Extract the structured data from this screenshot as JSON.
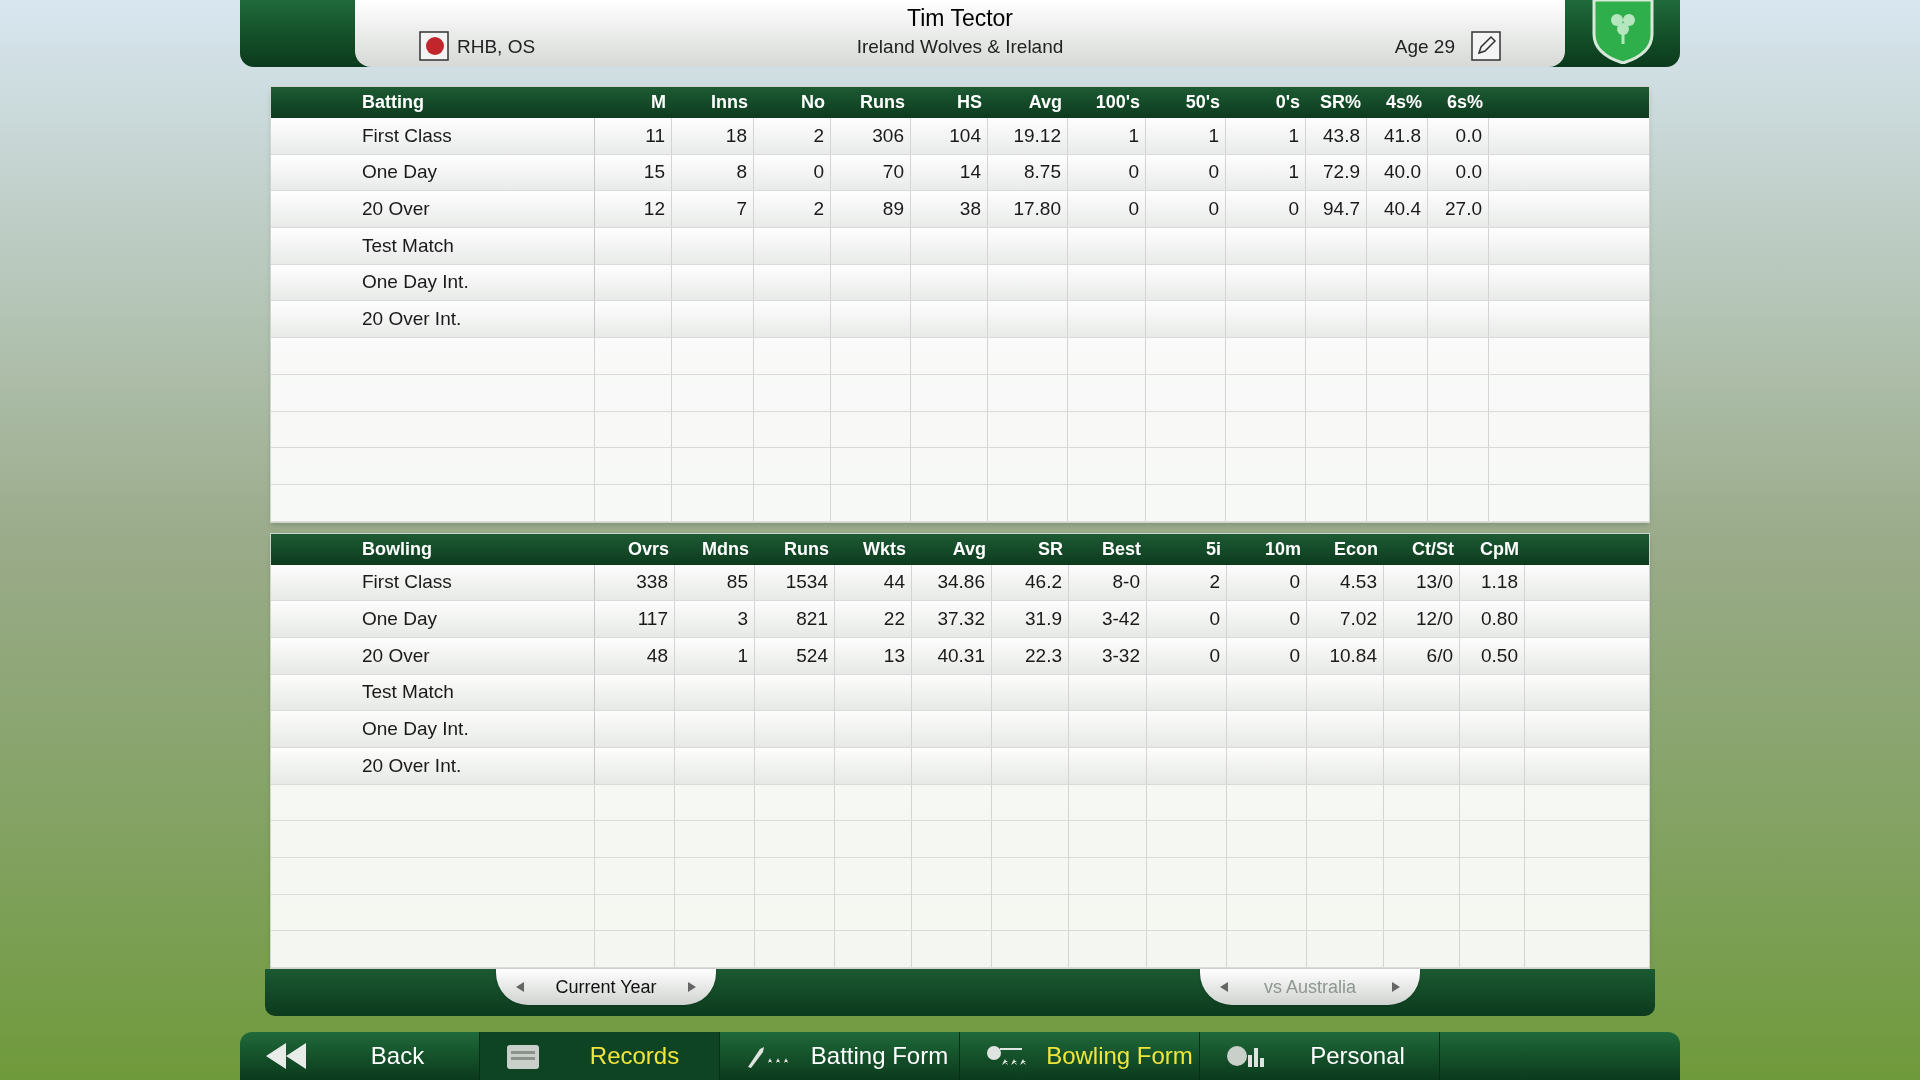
{
  "header": {
    "name": "Tim Tector",
    "handedness": "RHB, OS",
    "team": "Ireland Wolves & Ireland",
    "age": "Age 29"
  },
  "batting": {
    "columns": [
      "Batting",
      "M",
      "Inns",
      "No",
      "Runs",
      "HS",
      "Avg",
      "100's",
      "50's",
      "0's",
      "SR%",
      "4s%",
      "6s%"
    ],
    "rows": [
      {
        "label": "First Class",
        "cells": [
          "11",
          "18",
          "2",
          "306",
          "104",
          "19.12",
          "1",
          "1",
          "1",
          "43.8",
          "41.8",
          "0.0"
        ]
      },
      {
        "label": "One Day",
        "cells": [
          "15",
          "8",
          "0",
          "70",
          "14",
          "8.75",
          "0",
          "0",
          "1",
          "72.9",
          "40.0",
          "0.0"
        ]
      },
      {
        "label": "20 Over",
        "cells": [
          "12",
          "7",
          "2",
          "89",
          "38",
          "17.80",
          "0",
          "0",
          "0",
          "94.7",
          "40.4",
          "27.0"
        ]
      },
      {
        "label": "Test Match"
      },
      {
        "label": "One Day Int."
      },
      {
        "label": "20 Over Int."
      }
    ]
  },
  "bowling": {
    "columns": [
      "Bowling",
      "Ovrs",
      "Mdns",
      "Runs",
      "Wkts",
      "Avg",
      "SR",
      "Best",
      "5i",
      "10m",
      "Econ",
      "Ct/St",
      "CpM"
    ],
    "rows": [
      {
        "label": "First Class",
        "cells": [
          "338",
          "85",
          "1534",
          "44",
          "34.86",
          "46.2",
          "8-0",
          "2",
          "0",
          "4.53",
          "13/0",
          "1.18"
        ]
      },
      {
        "label": "One Day",
        "cells": [
          "117",
          "3",
          "821",
          "22",
          "37.32",
          "31.9",
          "3-42",
          "0",
          "0",
          "7.02",
          "12/0",
          "0.80"
        ]
      },
      {
        "label": "20 Over",
        "cells": [
          "48",
          "1",
          "524",
          "13",
          "40.31",
          "22.3",
          "3-32",
          "0",
          "0",
          "10.84",
          "6/0",
          "0.50"
        ]
      },
      {
        "label": "Test Match"
      },
      {
        "label": "One Day Int."
      },
      {
        "label": "20 Over Int."
      }
    ]
  },
  "period_selector": {
    "label": "Current Year",
    "disabled": false
  },
  "opponent_selector": {
    "label": "vs Australia",
    "disabled": true
  },
  "nav": [
    {
      "kind": "back",
      "label": "Back",
      "selected": false,
      "highlighted": false
    },
    {
      "kind": "records",
      "label": "Records",
      "selected": true,
      "highlighted": true
    },
    {
      "kind": "batting",
      "label": "Batting Form",
      "selected": false,
      "highlighted": false
    },
    {
      "kind": "bowling",
      "label": "Bowling Form",
      "selected": false,
      "highlighted": true
    },
    {
      "kind": "personal",
      "label": "Personal",
      "selected": false,
      "highlighted": false
    }
  ]
}
